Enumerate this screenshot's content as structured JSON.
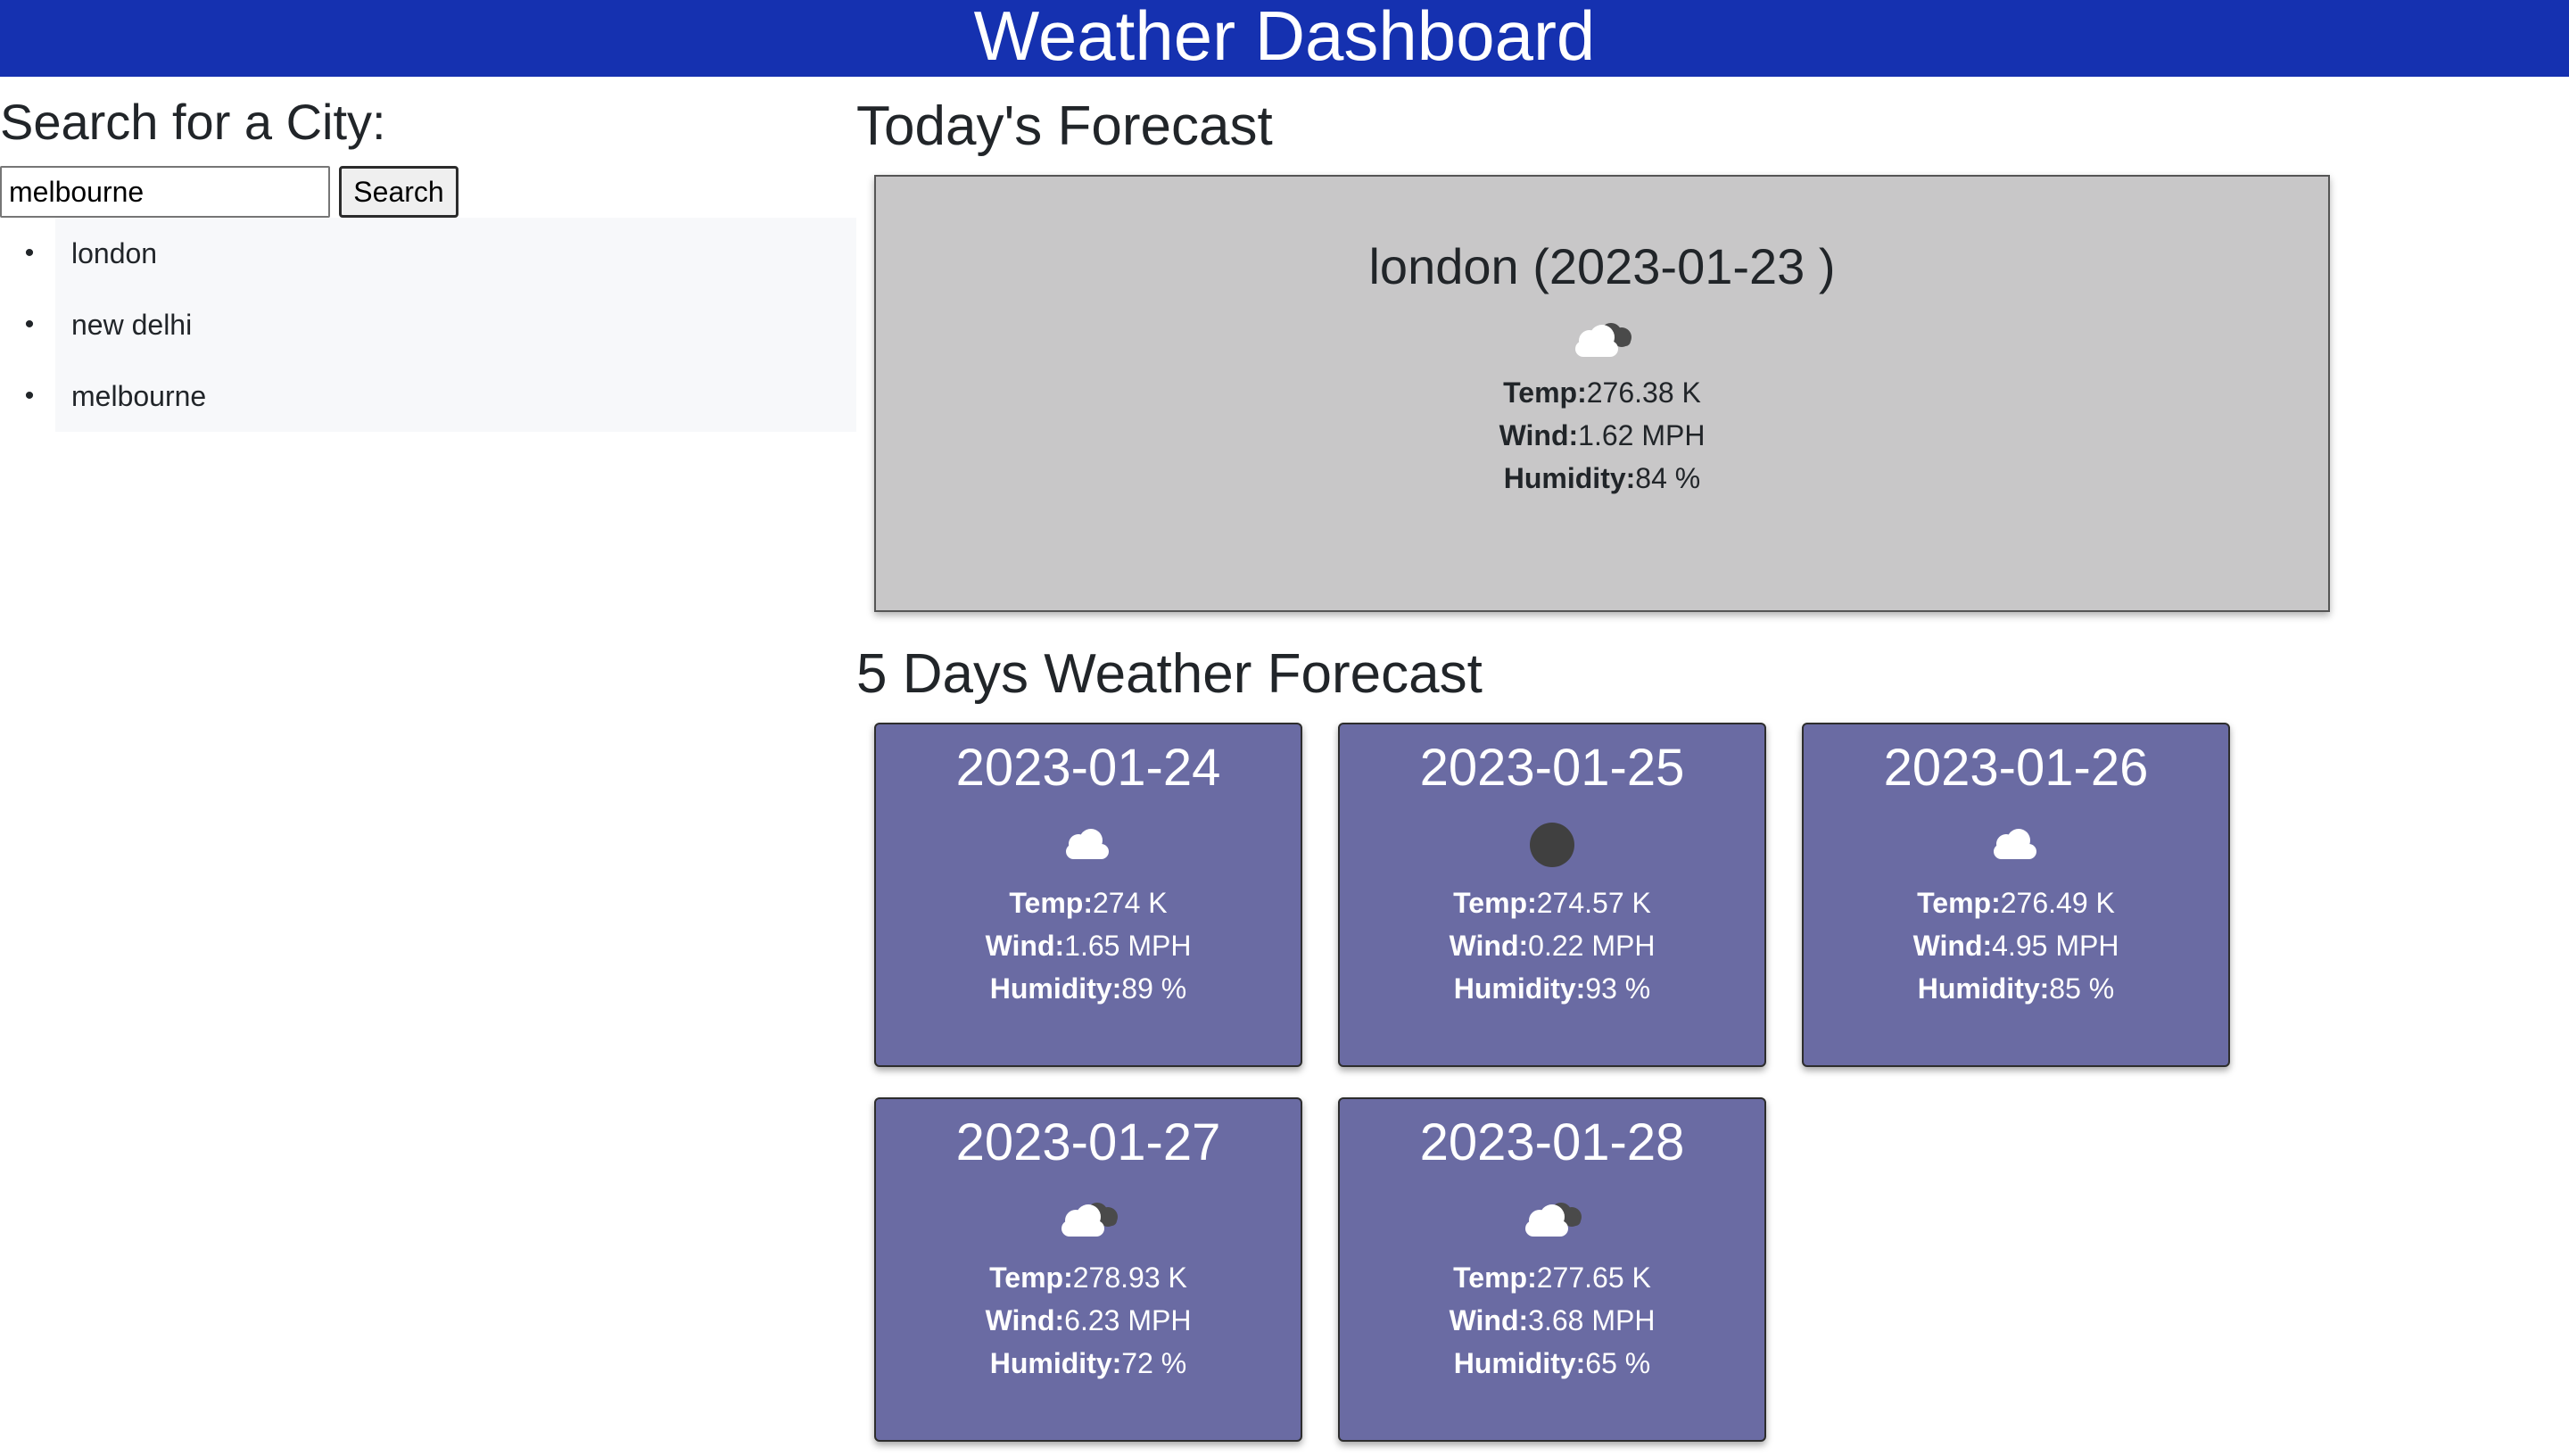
{
  "header": {
    "title": "Weather Dashboard"
  },
  "search": {
    "heading": "Search for a City:",
    "input_value": "melbourne",
    "button_label": "Search"
  },
  "history": [
    "london",
    "new delhi",
    "melbourne"
  ],
  "today": {
    "section_title": "Today's Forecast",
    "title": "london (2023-01-23 )",
    "icon": "broken-clouds-icon",
    "temp_label": "Temp:",
    "temp": "276.38 K",
    "wind_label": "Wind:",
    "wind": "1.62 MPH",
    "humidity_label": "Humidity:",
    "humidity": "84 %"
  },
  "forecast": {
    "section_title": "5 Days Weather Forecast",
    "days": [
      {
        "date": "2023-01-24",
        "icon": "cloud-icon",
        "temp": "274 K",
        "wind": "1.65 MPH",
        "humidity": "89 %"
      },
      {
        "date": "2023-01-25",
        "icon": "overcast-icon",
        "temp": "274.57 K",
        "wind": "0.22 MPH",
        "humidity": "93 %"
      },
      {
        "date": "2023-01-26",
        "icon": "cloud-icon",
        "temp": "276.49 K",
        "wind": "4.95 MPH",
        "humidity": "85 %"
      },
      {
        "date": "2023-01-27",
        "icon": "broken-clouds-icon",
        "temp": "278.93 K",
        "wind": "6.23 MPH",
        "humidity": "72 %"
      },
      {
        "date": "2023-01-28",
        "icon": "broken-clouds-icon",
        "temp": "277.65 K",
        "wind": "3.68 MPH",
        "humidity": "65 %"
      }
    ],
    "temp_label": "Temp:",
    "wind_label": "Wind:",
    "humidity_label": "Humidity:"
  }
}
